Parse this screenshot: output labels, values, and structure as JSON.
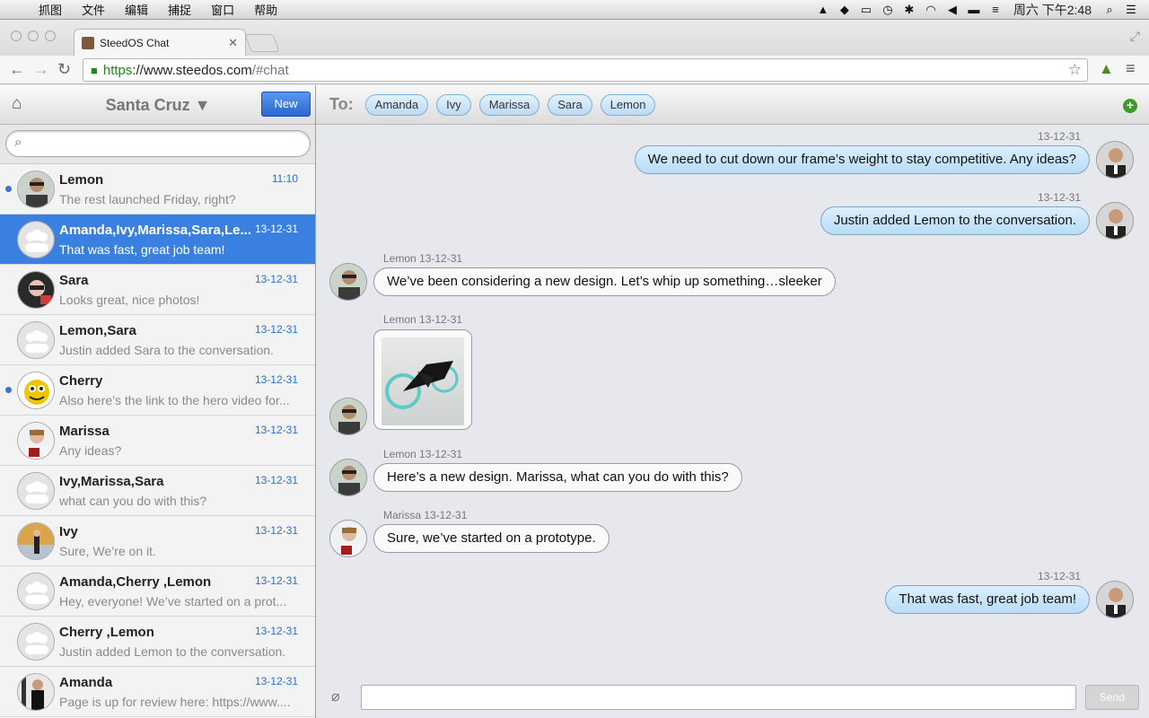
{
  "menubar": {
    "items": [
      "抓图",
      "文件",
      "编辑",
      "捕捉",
      "窗口",
      "帮助"
    ],
    "clock": "周六 下午2:48"
  },
  "browser": {
    "tab_title": "SteedOS Chat",
    "url_https": "https",
    "url_host": "://www.steedos.com",
    "url_path": "/#chat",
    "ext_badge": "1"
  },
  "sidebar": {
    "space_name": "Santa Cruz ▼",
    "new_label": "New",
    "search_placeholder": "",
    "conversations": [
      {
        "name": "Lemon",
        "time": "11:10",
        "snippet": "The rest launched Friday, right?",
        "unread": true,
        "avatar": "lemon",
        "selected": false
      },
      {
        "name": "Amanda,Ivy,Marissa,Sara,Le...",
        "time": "13-12-31",
        "snippet": "That was fast, great job team!",
        "unread": false,
        "avatar": "group",
        "selected": true
      },
      {
        "name": "Sara",
        "time": "13-12-31",
        "snippet": "Looks great, nice photos!",
        "unread": false,
        "avatar": "sara",
        "selected": false
      },
      {
        "name": "Lemon,Sara",
        "time": "13-12-31",
        "snippet": "Justin added Sara to the conversation.",
        "unread": false,
        "avatar": "group",
        "selected": false
      },
      {
        "name": "Cherry",
        "time": "13-12-31",
        "snippet": "Also here’s the link to the hero video for...",
        "unread": true,
        "avatar": "cherry",
        "selected": false
      },
      {
        "name": "Marissa",
        "time": "13-12-31",
        "snippet": "Any ideas?",
        "unread": false,
        "avatar": "marissa",
        "selected": false
      },
      {
        "name": "Ivy,Marissa,Sara",
        "time": "13-12-31",
        "snippet": "what can you do with this?",
        "unread": false,
        "avatar": "group",
        "selected": false
      },
      {
        "name": "Ivy",
        "time": "13-12-31",
        "snippet": "Sure, We’re on it.",
        "unread": false,
        "avatar": "ivy",
        "selected": false
      },
      {
        "name": "Amanda,Cherry ,Lemon",
        "time": "13-12-31",
        "snippet": "Hey, everyone! We’ve started on a prot...",
        "unread": false,
        "avatar": "group",
        "selected": false
      },
      {
        "name": "Cherry ,Lemon",
        "time": "13-12-31",
        "snippet": "Justin added Lemon to the conversation.",
        "unread": false,
        "avatar": "group",
        "selected": false
      },
      {
        "name": "Amanda",
        "time": "13-12-31",
        "snippet": "Page is up for review here: https://www....",
        "unread": false,
        "avatar": "amanda",
        "selected": false
      }
    ]
  },
  "chat": {
    "to_label": "To:",
    "recipients": [
      "Amanda",
      "Ivy",
      "Marissa",
      "Sara",
      "Lemon"
    ],
    "messages": [
      {
        "dir": "out",
        "meta": "13-12-31",
        "text": "We need to cut down our frame’s weight to stay competitive. Any ideas?"
      },
      {
        "dir": "out",
        "meta": "13-12-31",
        "text": "Justin added Lemon to the conversation."
      },
      {
        "dir": "in",
        "meta": "Lemon 13-12-31",
        "text": "We’ve been considering a new design. Let’s whip up something…sleeker"
      },
      {
        "dir": "in",
        "meta": "Lemon 13-12-31",
        "image": "bicycle-photo"
      },
      {
        "dir": "in",
        "meta": "Lemon 13-12-31",
        "text": "Here’s a new design. Marissa, what can you do with this?"
      },
      {
        "dir": "in",
        "meta": "Marissa 13-12-31",
        "text": "Sure, we’ve started on a prototype."
      },
      {
        "dir": "out",
        "meta": "13-12-31",
        "text": "That was fast, great job team!"
      }
    ],
    "send_label": "Send"
  }
}
